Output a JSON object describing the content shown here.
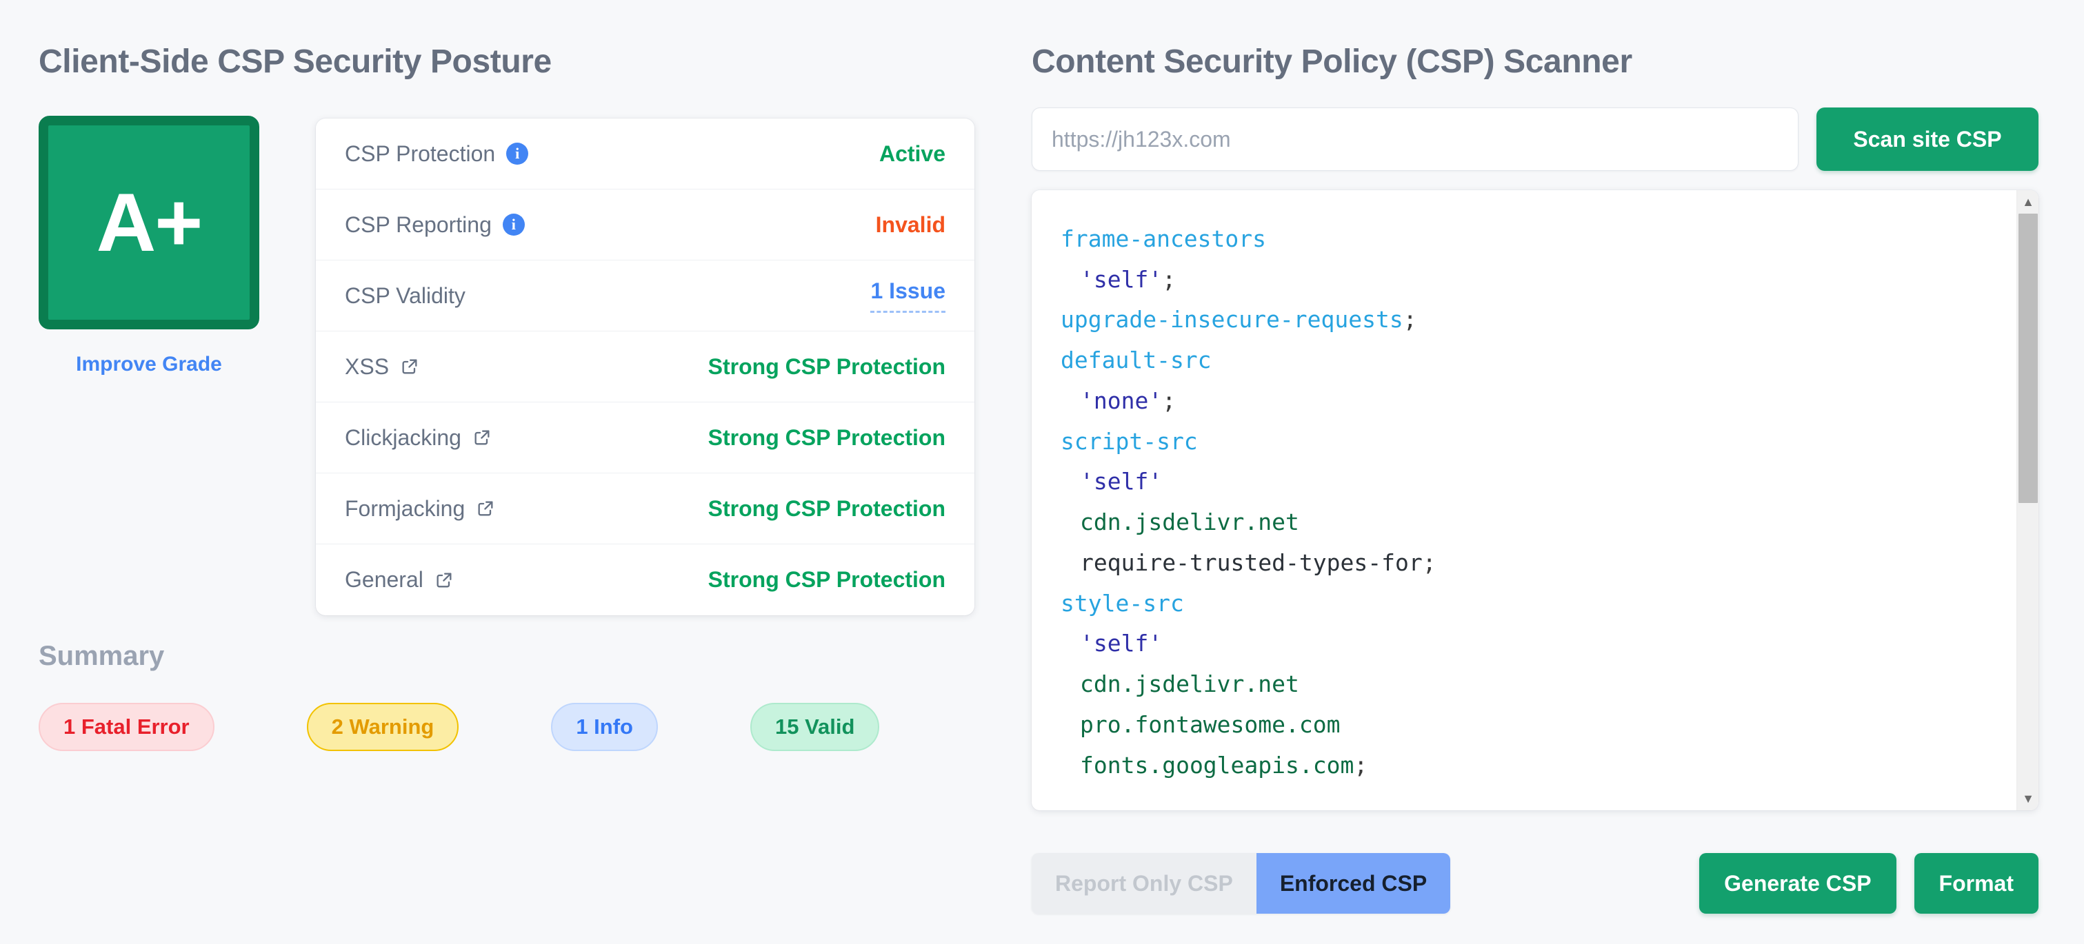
{
  "colors": {
    "page_bg": "#f7f8fa",
    "grade_fill": "#13a06d",
    "grade_border": "#0a7d4f",
    "accent_green": "#13a06d",
    "accent_blue": "#4285f4",
    "status_green": "#06a35e",
    "status_orange": "#f4531d",
    "segment_active": "#79a5f9",
    "heading_gray": "#656e7e"
  },
  "left": {
    "title": "Client-Side CSP Security Posture",
    "grade": "A+",
    "improve_grade_label": "Improve Grade",
    "rows": [
      {
        "label": "CSP Protection",
        "icon": "info-icon",
        "value": "Active",
        "value_style": "green"
      },
      {
        "label": "CSP Reporting",
        "icon": "info-icon",
        "value": "Invalid",
        "value_style": "orange"
      },
      {
        "label": "CSP Validity",
        "icon": "none",
        "value": "1 Issue",
        "value_style": "blue-dashed"
      },
      {
        "label": "XSS",
        "icon": "external-link-icon",
        "value": "Strong CSP Protection",
        "value_style": "green"
      },
      {
        "label": "Clickjacking",
        "icon": "external-link-icon",
        "value": "Strong CSP Protection",
        "value_style": "green"
      },
      {
        "label": "Formjacking",
        "icon": "external-link-icon",
        "value": "Strong CSP Protection",
        "value_style": "green"
      },
      {
        "label": "General",
        "icon": "external-link-icon",
        "value": "Strong CSP Protection",
        "value_style": "green"
      }
    ],
    "summary": {
      "title": "Summary",
      "badges": [
        {
          "label": "1 Fatal Error",
          "kind": "fatal"
        },
        {
          "label": "2 Warning",
          "kind": "warning"
        },
        {
          "label": "1 Info",
          "kind": "info"
        },
        {
          "label": "15 Valid",
          "kind": "valid"
        }
      ]
    }
  },
  "right": {
    "title": "Content Security Policy (CSP) Scanner",
    "url_input": {
      "value": "",
      "placeholder": "https://jh123x.com"
    },
    "scan_button": "Scan site CSP",
    "csp_text": "frame-ancestors\n  'self';\nupgrade-insecure-requests;\ndefault-src\n  'none';\nscript-src\n  'self'\n  cdn.jsdelivr.net\n  require-trusted-types-for;\nstyle-src\n  'self'\n  cdn.jsdelivr.net\n  pro.fontawesome.com\n  fonts.googleapis.com;",
    "csp_lines": [
      {
        "indent": 0,
        "tokens": [
          {
            "t": "frame-ancestors",
            "c": "dir"
          }
        ]
      },
      {
        "indent": 1,
        "tokens": [
          {
            "t": "'self'",
            "c": "kw"
          },
          {
            "t": ";",
            "c": "punct"
          }
        ]
      },
      {
        "indent": 0,
        "tokens": [
          {
            "t": "upgrade-insecure-requests",
            "c": "dir"
          },
          {
            "t": ";",
            "c": "punct"
          }
        ]
      },
      {
        "indent": 0,
        "tokens": [
          {
            "t": "default-src",
            "c": "dir"
          }
        ]
      },
      {
        "indent": 1,
        "tokens": [
          {
            "t": "'none'",
            "c": "kw"
          },
          {
            "t": ";",
            "c": "punct"
          }
        ]
      },
      {
        "indent": 0,
        "tokens": [
          {
            "t": "script-src",
            "c": "dir"
          }
        ]
      },
      {
        "indent": 1,
        "tokens": [
          {
            "t": "'self'",
            "c": "kw"
          }
        ]
      },
      {
        "indent": 1,
        "tokens": [
          {
            "t": "cdn.jsdelivr.net",
            "c": "host"
          }
        ]
      },
      {
        "indent": 1,
        "tokens": [
          {
            "t": "require-trusted-types-for",
            "c": "plain"
          },
          {
            "t": ";",
            "c": "punct"
          }
        ]
      },
      {
        "indent": 0,
        "tokens": [
          {
            "t": "style-src",
            "c": "dir"
          }
        ]
      },
      {
        "indent": 1,
        "tokens": [
          {
            "t": "'self'",
            "c": "kw"
          }
        ]
      },
      {
        "indent": 1,
        "tokens": [
          {
            "t": "cdn.jsdelivr.net",
            "c": "host"
          }
        ]
      },
      {
        "indent": 1,
        "tokens": [
          {
            "t": "pro.fontawesome.com",
            "c": "host"
          }
        ]
      },
      {
        "indent": 1,
        "tokens": [
          {
            "t": "fonts.googleapis.com",
            "c": "host"
          },
          {
            "t": ";",
            "c": "punct"
          }
        ]
      }
    ],
    "scrollbar": {
      "up_arrow": "▲",
      "down_arrow": "▼"
    },
    "mode_toggle": {
      "report_only_label": "Report Only CSP",
      "enforced_label": "Enforced CSP",
      "selected": "Enforced CSP"
    },
    "generate_button": "Generate CSP",
    "format_button": "Format"
  }
}
